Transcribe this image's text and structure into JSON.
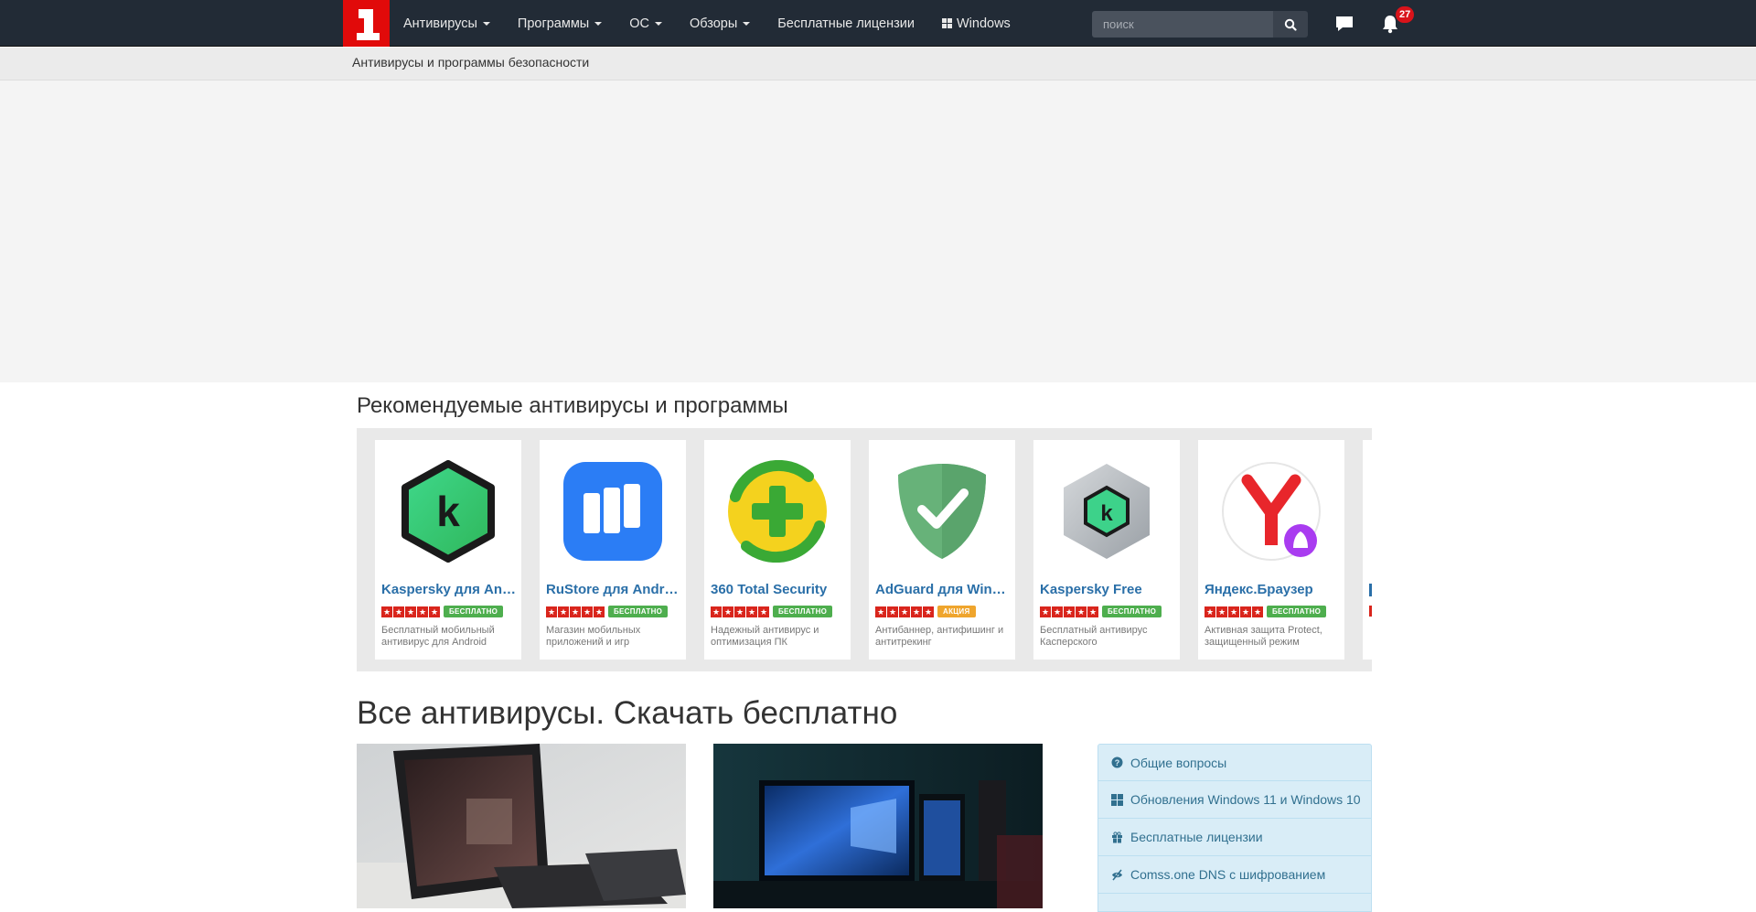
{
  "navbar": {
    "logo_text": "1",
    "items": [
      {
        "label": "Антивирусы",
        "dropdown": true
      },
      {
        "label": "Программы",
        "dropdown": true
      },
      {
        "label": "ОС",
        "dropdown": true
      },
      {
        "label": "Обзоры",
        "dropdown": true
      },
      {
        "label": "Бесплатные лицензии",
        "dropdown": false
      },
      {
        "label": "Windows",
        "dropdown": false,
        "icon": "windows-icon"
      }
    ],
    "search_placeholder": "поиск",
    "notifications_count": "27"
  },
  "breadcrumb": "Антивирусы и программы безопасности",
  "recommended": {
    "title": "Рекомендуемые антивирусы и программы",
    "cards": [
      {
        "title": "Kaspersky для Android",
        "tag": "БЕСПЛАТНО",
        "tag_type": "free",
        "desc": "Бесплатный мобильный антивирус для Android",
        "icon": "kaspersky-android-icon"
      },
      {
        "title": "RuStore для Android",
        "tag": "БЕСПЛАТНО",
        "tag_type": "free",
        "desc": "Магазин мобильных приложений и игр",
        "icon": "rustore-icon"
      },
      {
        "title": "360 Total Security",
        "tag": "БЕСПЛАТНО",
        "tag_type": "free",
        "desc": "Надежный антивирус и оптимизация ПК",
        "icon": "360-total-security-icon"
      },
      {
        "title": "AdGuard для Windows",
        "tag": "АКЦИЯ",
        "tag_type": "promo",
        "desc": "Антибаннер, антифишинг и антитрекинг",
        "icon": "adguard-icon"
      },
      {
        "title": "Kaspersky Free",
        "tag": "БЕСПЛАТНО",
        "tag_type": "free",
        "desc": "Бесплатный антивирус Касперского",
        "icon": "kaspersky-free-icon"
      },
      {
        "title": "Яндекс.Браузер",
        "tag": "БЕСПЛАТНО",
        "tag_type": "free",
        "desc": "Активная защита Protect, защищенный режим",
        "icon": "yandex-browser-icon"
      }
    ]
  },
  "all": {
    "title": "Все антивирусы. Скачать бесплатно"
  },
  "sidebar": {
    "items": [
      {
        "label": "Общие вопросы",
        "icon": "question-circle-icon"
      },
      {
        "label": "Обновления Windows 11 и Windows 10",
        "icon": "windows-icon"
      },
      {
        "label": "Бесплатные лицензии",
        "icon": "gift-icon"
      },
      {
        "label": "Comss.one DNS с шифрованием",
        "icon": "eye-slash-icon"
      }
    ]
  },
  "colors": {
    "navbar": "#222b36",
    "logo": "#e10a0a",
    "link": "#2a6fa8",
    "free_tag": "#4eae4e",
    "promo_tag": "#efa52d",
    "sidebar_bg": "#d9edf7"
  }
}
